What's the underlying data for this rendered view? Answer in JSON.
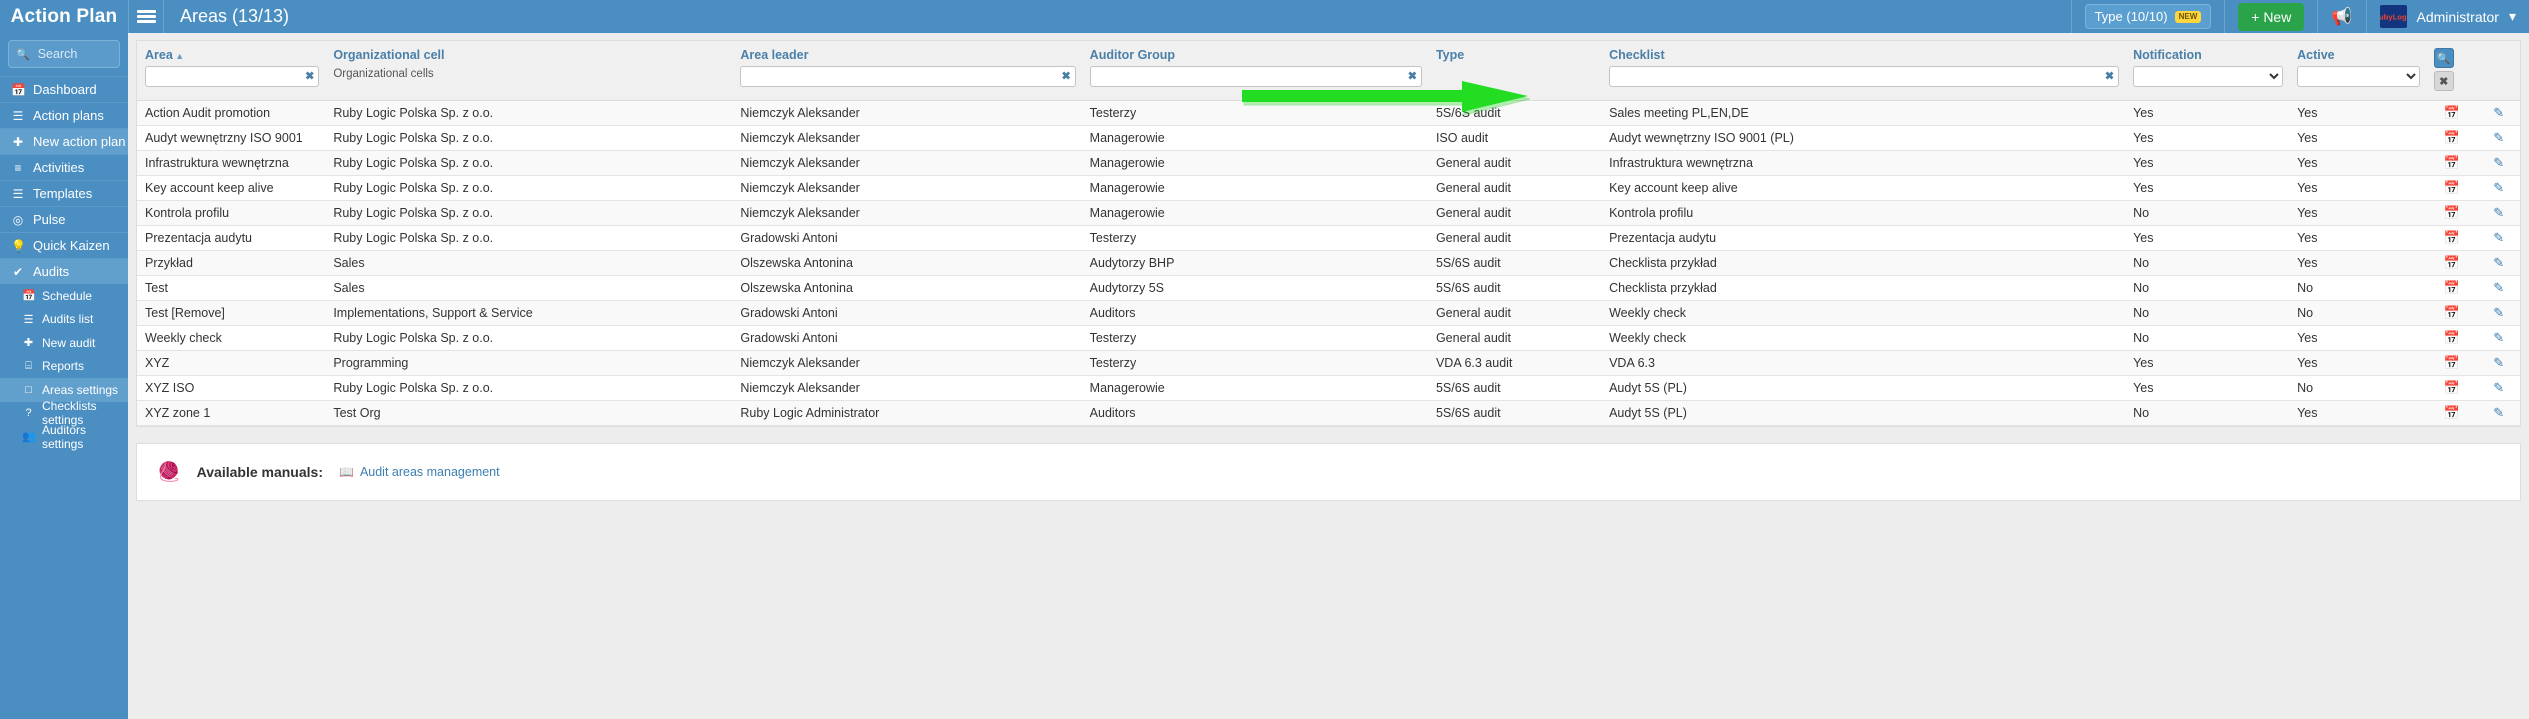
{
  "app": {
    "brand": "Action Plan",
    "page_title": "Areas (13/13)",
    "menu_icon": "hamburger-icon"
  },
  "topbar": {
    "type_chip": "Type (10/10)",
    "type_badge": "NEW",
    "new_button": "+ New",
    "megaphone_icon": "megaphone-icon",
    "logo_text": "RubyLogic",
    "user": "Administrator",
    "caret": "▾"
  },
  "sidebar": {
    "search_placeholder": "Search",
    "search_value": "",
    "items": [
      {
        "label": "Dashboard",
        "icon": "calendar-icon",
        "active": false
      },
      {
        "label": "Action plans",
        "icon": "list-icon",
        "active": false
      },
      {
        "label": "New action plan",
        "icon": "plus-icon",
        "active": true
      },
      {
        "label": "Activities",
        "icon": "sliders-icon",
        "active": false
      },
      {
        "label": "Templates",
        "icon": "menu-icon",
        "active": false
      },
      {
        "label": "Pulse",
        "icon": "target-icon",
        "active": false
      },
      {
        "label": "Quick Kaizen",
        "icon": "bulb-icon",
        "active": false
      },
      {
        "label": "Audits",
        "icon": "check-icon",
        "active": true
      }
    ],
    "sub_items": [
      {
        "label": "Schedule",
        "icon": "calendar-icon",
        "active": false
      },
      {
        "label": "Audits list",
        "icon": "list-icon",
        "active": false
      },
      {
        "label": "New audit",
        "icon": "plus-icon",
        "active": false
      },
      {
        "label": "Reports",
        "icon": "table-icon",
        "active": false
      },
      {
        "label": "Areas settings",
        "icon": "square-icon",
        "active": true
      },
      {
        "label": "Checklists settings",
        "icon": "question-icon",
        "active": false
      },
      {
        "label": "Auditors settings",
        "icon": "people-icon",
        "active": false
      }
    ]
  },
  "table": {
    "columns": [
      {
        "key": "area",
        "label": "Area",
        "sorted": true,
        "sort_dir": "▲",
        "filter": "input",
        "value": "",
        "sub": ""
      },
      {
        "key": "org_cell",
        "label": "Organizational cell",
        "sorted": false,
        "sort_dir": "",
        "filter": "none",
        "value": "",
        "sub": "Organizational cells"
      },
      {
        "key": "leader",
        "label": "Area leader",
        "sorted": false,
        "sort_dir": "",
        "filter": "input",
        "value": "",
        "sub": ""
      },
      {
        "key": "group",
        "label": "Auditor Group",
        "sorted": false,
        "sort_dir": "",
        "filter": "input",
        "value": "",
        "sub": ""
      },
      {
        "key": "type",
        "label": "Type",
        "sorted": false,
        "sort_dir": "",
        "filter": "none",
        "value": "",
        "sub": ""
      },
      {
        "key": "checklist",
        "label": "Checklist",
        "sorted": false,
        "sort_dir": "",
        "filter": "input",
        "value": "",
        "sub": ""
      },
      {
        "key": "notif",
        "label": "Notification",
        "sorted": false,
        "sort_dir": "",
        "filter": "select",
        "value": "",
        "sub": ""
      },
      {
        "key": "active",
        "label": "Active",
        "sorted": false,
        "sort_dir": "",
        "filter": "select",
        "value": "",
        "sub": ""
      }
    ],
    "clear_symbol": "✖",
    "search_button_icon": "search-icon",
    "clear_button_icon": "close-icon",
    "row_icons": {
      "schedule": "calendar-check-icon",
      "edit": "pencil-icon"
    },
    "rows": [
      {
        "area": "Action Audit promotion",
        "org_cell": "Ruby Logic Polska Sp. z o.o.",
        "leader": "Niemczyk Aleksander",
        "group": "Testerzy",
        "type": "5S/6S audit",
        "checklist": "Sales meeting PL,EN,DE",
        "notif": "Yes",
        "active": "Yes"
      },
      {
        "area": "Audyt wewnętrzny ISO 9001",
        "org_cell": "Ruby Logic Polska Sp. z o.o.",
        "leader": "Niemczyk Aleksander",
        "group": "Managerowie",
        "type": "ISO audit",
        "checklist": "Audyt wewnętrzny ISO 9001 (PL)",
        "notif": "Yes",
        "active": "Yes"
      },
      {
        "area": "Infrastruktura wewnętrzna",
        "org_cell": "Ruby Logic Polska Sp. z o.o.",
        "leader": "Niemczyk Aleksander",
        "group": "Managerowie",
        "type": "General audit",
        "checklist": "Infrastruktura wewnętrzna",
        "notif": "Yes",
        "active": "Yes"
      },
      {
        "area": "Key account keep alive",
        "org_cell": "Ruby Logic Polska Sp. z o.o.",
        "leader": "Niemczyk Aleksander",
        "group": "Managerowie",
        "type": "General audit",
        "checklist": "Key account keep alive",
        "notif": "Yes",
        "active": "Yes"
      },
      {
        "area": "Kontrola profilu",
        "org_cell": "Ruby Logic Polska Sp. z o.o.",
        "leader": "Niemczyk Aleksander",
        "group": "Managerowie",
        "type": "General audit",
        "checklist": "Kontrola profilu",
        "notif": "No",
        "active": "Yes"
      },
      {
        "area": "Prezentacja audytu",
        "org_cell": "Ruby Logic Polska Sp. z o.o.",
        "leader": "Gradowski Antoni",
        "group": "Testerzy",
        "type": "General audit",
        "checklist": "Prezentacja audytu",
        "notif": "Yes",
        "active": "Yes"
      },
      {
        "area": "Przykład",
        "org_cell": "Sales",
        "leader": "Olszewska Antonina",
        "group": "Audytorzy BHP",
        "type": "5S/6S audit",
        "checklist": "Checklista przykład",
        "notif": "No",
        "active": "Yes"
      },
      {
        "area": "Test",
        "org_cell": "Sales",
        "leader": "Olszewska Antonina",
        "group": "Audytorzy 5S",
        "type": "5S/6S audit",
        "checklist": "Checklista przykład",
        "notif": "No",
        "active": "No"
      },
      {
        "area": "Test [Remove]",
        "org_cell": "Implementations, Support & Service",
        "leader": "Gradowski Antoni",
        "group": "Auditors",
        "type": "General audit",
        "checklist": "Weekly check",
        "notif": "No",
        "active": "No"
      },
      {
        "area": "Weekly check",
        "org_cell": "Ruby Logic Polska Sp. z o.o.",
        "leader": "Gradowski Antoni",
        "group": "Testerzy",
        "type": "General audit",
        "checklist": "Weekly check",
        "notif": "No",
        "active": "Yes"
      },
      {
        "area": "XYZ",
        "org_cell": "Programming",
        "leader": "Niemczyk Aleksander",
        "group": "Testerzy",
        "type": "VDA 6.3 audit",
        "checklist": "VDA 6.3",
        "notif": "Yes",
        "active": "Yes"
      },
      {
        "area": "XYZ ISO",
        "org_cell": "Ruby Logic Polska Sp. z o.o.",
        "leader": "Niemczyk Aleksander",
        "group": "Managerowie",
        "type": "5S/6S audit",
        "checklist": "Audyt 5S (PL)",
        "notif": "Yes",
        "active": "No"
      },
      {
        "area": "XYZ zone 1",
        "org_cell": "Test Org",
        "leader": "Ruby Logic Administrator",
        "group": "Auditors",
        "type": "5S/6S audit",
        "checklist": "Audyt 5S (PL)",
        "notif": "No",
        "active": "Yes"
      }
    ]
  },
  "manuals": {
    "wand_icon": "wand-icon",
    "title": "Available manuals:",
    "link_icon": "book-icon",
    "link_label": "Audit areas management"
  },
  "annotation": {
    "arrow_color": "#22dd22",
    "arrow_direction": "right"
  },
  "colors": {
    "brand_blue": "#4a8ec2",
    "accent_green": "#2aa34a",
    "header_text": "#4a7fa8",
    "badge_yellow": "#ffd53e"
  }
}
